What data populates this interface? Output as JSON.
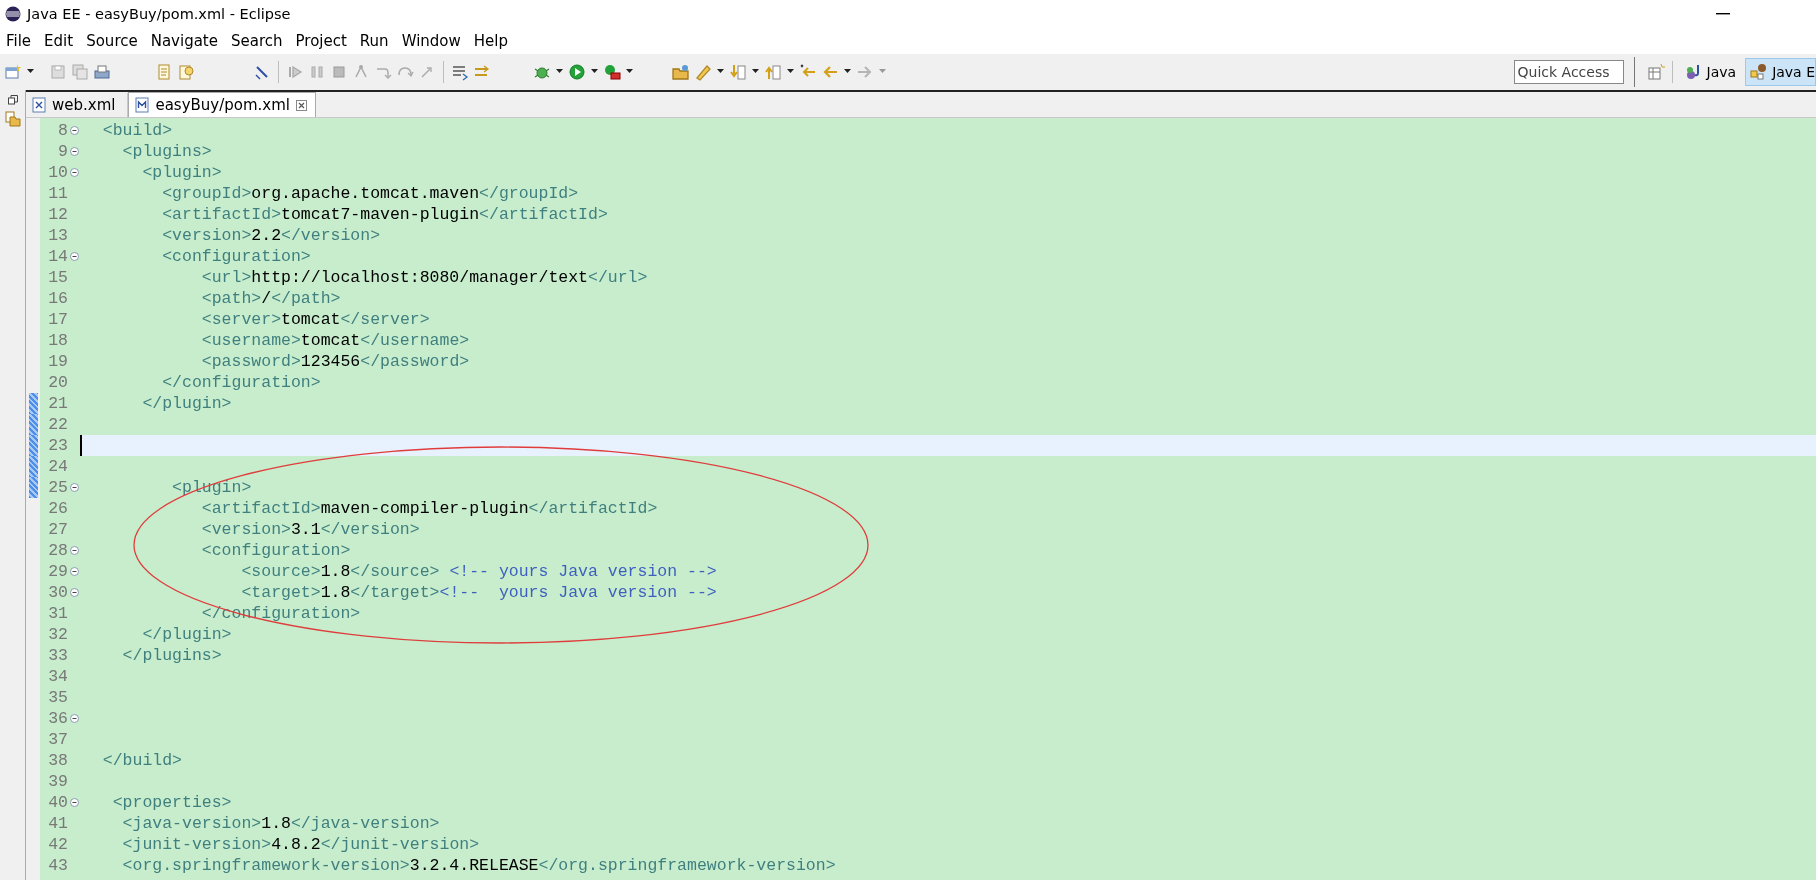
{
  "window": {
    "title": "Java EE - easyBuy/pom.xml - Eclipse"
  },
  "menu": [
    "File",
    "Edit",
    "Source",
    "Navigate",
    "Search",
    "Project",
    "Run",
    "Window",
    "Help"
  ],
  "quick_access": {
    "placeholder": "Quick Access"
  },
  "perspectives": [
    {
      "label": "Java",
      "kind": "java",
      "selected": false
    },
    {
      "label": "Java E",
      "kind": "javaee",
      "selected": true
    }
  ],
  "tabs": [
    {
      "label": "web.xml",
      "kind": "xml",
      "selected": false
    },
    {
      "label": "easyBuy/pom.xml",
      "kind": "maven",
      "selected": true
    }
  ],
  "editor": {
    "lines": [
      {
        "number": "8",
        "fold": true,
        "changed": false,
        "current": false,
        "segments": [
          {
            "kind": "tag",
            "text": "  <build>"
          }
        ]
      },
      {
        "number": "9",
        "fold": true,
        "changed": false,
        "current": false,
        "segments": [
          {
            "kind": "tag",
            "text": "    <plugins>"
          }
        ]
      },
      {
        "number": "10",
        "fold": true,
        "changed": false,
        "current": false,
        "segments": [
          {
            "kind": "tag",
            "text": "      <plugin>"
          }
        ]
      },
      {
        "number": "11",
        "fold": false,
        "changed": false,
        "current": false,
        "segments": [
          {
            "kind": "tag",
            "text": "        <groupId>"
          },
          {
            "kind": "value",
            "text": "org.apache.tomcat.maven"
          },
          {
            "kind": "tag",
            "text": "</groupId>"
          }
        ]
      },
      {
        "number": "12",
        "fold": false,
        "changed": false,
        "current": false,
        "segments": [
          {
            "kind": "tag",
            "text": "        <artifactId>"
          },
          {
            "kind": "value",
            "text": "tomcat7-maven-plugin"
          },
          {
            "kind": "tag",
            "text": "</artifactId>"
          }
        ]
      },
      {
        "number": "13",
        "fold": false,
        "changed": false,
        "current": false,
        "segments": [
          {
            "kind": "tag",
            "text": "        <version>"
          },
          {
            "kind": "value",
            "text": "2.2"
          },
          {
            "kind": "tag",
            "text": "</version>"
          }
        ]
      },
      {
        "number": "14",
        "fold": true,
        "changed": false,
        "current": false,
        "segments": [
          {
            "kind": "tag",
            "text": "        <configuration>"
          }
        ]
      },
      {
        "number": "15",
        "fold": false,
        "changed": false,
        "current": false,
        "segments": [
          {
            "kind": "tag",
            "text": "            <url>"
          },
          {
            "kind": "value",
            "text": "http://localhost:8080/manager/text"
          },
          {
            "kind": "tag",
            "text": "</url>"
          }
        ]
      },
      {
        "number": "16",
        "fold": false,
        "changed": false,
        "current": false,
        "segments": [
          {
            "kind": "tag",
            "text": "            <path>"
          },
          {
            "kind": "value",
            "text": "/"
          },
          {
            "kind": "tag",
            "text": "</path>"
          }
        ]
      },
      {
        "number": "17",
        "fold": false,
        "changed": false,
        "current": false,
        "segments": [
          {
            "kind": "tag",
            "text": "            <server>"
          },
          {
            "kind": "value",
            "text": "tomcat"
          },
          {
            "kind": "tag",
            "text": "</server>"
          }
        ]
      },
      {
        "number": "18",
        "fold": false,
        "changed": false,
        "current": false,
        "segments": [
          {
            "kind": "tag",
            "text": "            <username>"
          },
          {
            "kind": "value",
            "text": "tomcat"
          },
          {
            "kind": "tag",
            "text": "</username>"
          }
        ]
      },
      {
        "number": "19",
        "fold": false,
        "changed": false,
        "current": false,
        "segments": [
          {
            "kind": "tag",
            "text": "            <password>"
          },
          {
            "kind": "value",
            "text": "123456"
          },
          {
            "kind": "tag",
            "text": "</password>"
          }
        ]
      },
      {
        "number": "20",
        "fold": false,
        "changed": false,
        "current": false,
        "segments": [
          {
            "kind": "tag",
            "text": "        </configuration>"
          }
        ]
      },
      {
        "number": "21",
        "fold": false,
        "changed": true,
        "current": false,
        "segments": [
          {
            "kind": "tag",
            "text": "      </plugin>"
          }
        ]
      },
      {
        "number": "22",
        "fold": false,
        "changed": true,
        "current": false
      },
      {
        "number": "23",
        "fold": false,
        "changed": true,
        "current": true
      },
      {
        "number": "24",
        "fold": false,
        "changed": true,
        "current": false
      },
      {
        "number": "25",
        "fold": true,
        "changed": true,
        "current": false,
        "segments": [
          {
            "kind": "tag",
            "text": "         <plugin>"
          }
        ]
      },
      {
        "number": "26",
        "fold": false,
        "changed": false,
        "current": false,
        "segments": [
          {
            "kind": "tag",
            "text": "            <artifactId>"
          },
          {
            "kind": "value",
            "text": "maven-compiler-plugin"
          },
          {
            "kind": "tag",
            "text": "</artifactId>"
          }
        ]
      },
      {
        "number": "27",
        "fold": false,
        "changed": false,
        "current": false,
        "segments": [
          {
            "kind": "tag",
            "text": "            <version>"
          },
          {
            "kind": "value",
            "text": "3.1"
          },
          {
            "kind": "tag",
            "text": "</version>"
          }
        ]
      },
      {
        "number": "28",
        "fold": true,
        "changed": false,
        "current": false,
        "segments": [
          {
            "kind": "tag",
            "text": "            <configuration>"
          }
        ]
      },
      {
        "number": "29",
        "fold": true,
        "changed": false,
        "current": false,
        "segments": [
          {
            "kind": "tag",
            "text": "                <source>"
          },
          {
            "kind": "value",
            "text": "1.8"
          },
          {
            "kind": "tag",
            "text": "</source>"
          },
          {
            "kind": "comment",
            "text": " <!-- yours Java version -->"
          }
        ]
      },
      {
        "number": "30",
        "fold": true,
        "changed": false,
        "current": false,
        "segments": [
          {
            "kind": "tag",
            "text": "                <target>"
          },
          {
            "kind": "value",
            "text": "1.8"
          },
          {
            "kind": "tag",
            "text": "</target>"
          },
          {
            "kind": "comment",
            "text": "<!--  yours Java version -->"
          }
        ]
      },
      {
        "number": "31",
        "fold": false,
        "changed": false,
        "current": false,
        "segments": [
          {
            "kind": "tag",
            "text": "            </configuration>"
          }
        ]
      },
      {
        "number": "32",
        "fold": false,
        "changed": false,
        "current": false,
        "segments": [
          {
            "kind": "tag",
            "text": "      </plugin>"
          }
        ]
      },
      {
        "number": "33",
        "fold": false,
        "changed": false,
        "current": false,
        "segments": [
          {
            "kind": "tag",
            "text": "    </plugins>"
          }
        ]
      },
      {
        "number": "34",
        "fold": false,
        "changed": false,
        "current": false
      },
      {
        "number": "35",
        "fold": false,
        "changed": false,
        "current": false
      },
      {
        "number": "36",
        "fold": true,
        "changed": false,
        "current": false
      },
      {
        "number": "37",
        "fold": false,
        "changed": false,
        "current": false
      },
      {
        "number": "38",
        "fold": false,
        "changed": false,
        "current": false,
        "segments": [
          {
            "kind": "tag",
            "text": "  </build>"
          }
        ]
      },
      {
        "number": "39",
        "fold": false,
        "changed": false,
        "current": false
      },
      {
        "number": "40",
        "fold": true,
        "changed": false,
        "current": false,
        "segments": [
          {
            "kind": "tag",
            "text": "   <properties>"
          }
        ]
      },
      {
        "number": "41",
        "fold": false,
        "changed": false,
        "current": false,
        "segments": [
          {
            "kind": "tag",
            "text": "    <java-version>"
          },
          {
            "kind": "value",
            "text": "1.8"
          },
          {
            "kind": "tag",
            "text": "</java-version>"
          }
        ]
      },
      {
        "number": "42",
        "fold": false,
        "changed": false,
        "current": false,
        "segments": [
          {
            "kind": "tag",
            "text": "    <junit-version>"
          },
          {
            "kind": "value",
            "text": "4.8.2"
          },
          {
            "kind": "tag",
            "text": "</junit-version>"
          }
        ]
      },
      {
        "number": "43",
        "fold": false,
        "changed": false,
        "current": false,
        "segments": [
          {
            "kind": "tag",
            "text": "    <org.springframework-version>"
          },
          {
            "kind": "value",
            "text": "3.2.4.RELEASE"
          },
          {
            "kind": "tag",
            "text": "</org.springframework-version>"
          }
        ]
      }
    ]
  }
}
